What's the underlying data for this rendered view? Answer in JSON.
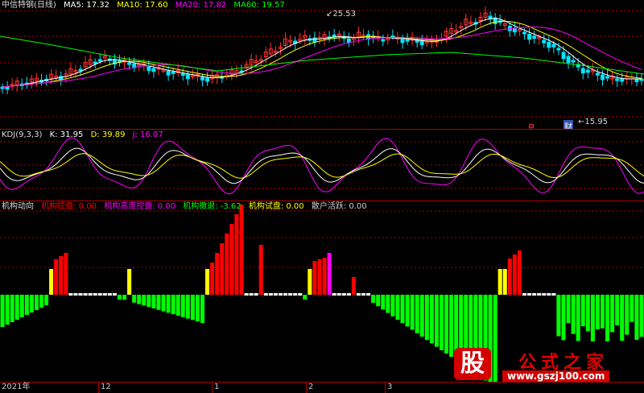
{
  "main_panel": {
    "title": "中信特钢(日线)",
    "ma": [
      {
        "label": "MA5: 17.32",
        "color": "#ffffff"
      },
      {
        "label": "MA10: 17.60",
        "color": "#ffff00"
      },
      {
        "label": "MA20: 17.82",
        "color": "#ff00ff"
      },
      {
        "label": "MA60: 19.57",
        "color": "#00ff00"
      }
    ],
    "high_label": "25.53",
    "low_label": "15.95",
    "event_mark_1": "息",
    "event_mark_2": "财"
  },
  "kdj_panel": {
    "title": "KDJ(9,3,3)",
    "k": "K: 31.95",
    "d": "D: 39.89",
    "j": "J: 16.07"
  },
  "inst_panel": {
    "title": "机构动向",
    "items": [
      {
        "label": "机构控盘: 0.00",
        "color": "#ff0000"
      },
      {
        "label": "机构高度控盘: 0.00",
        "color": "#ff00ff"
      },
      {
        "label": "机构撤退: -3.62",
        "color": "#00ff00"
      },
      {
        "label": "机构试盘: 0.00",
        "color": "#ffff00"
      },
      {
        "label": "散户活跃: 0.00",
        "color": "#cccccc"
      }
    ]
  },
  "xaxis": {
    "labels": [
      "2021年",
      "12",
      "1",
      "2",
      "3"
    ]
  },
  "watermark": {
    "glyph": "股",
    "name": "公式之家",
    "url": "www.gszj100.com"
  },
  "colors": {
    "up": "#ff3333",
    "down": "#00e5ff",
    "grid": "#b00000",
    "bar_red": "#ff0000",
    "bar_green": "#00ff00",
    "bar_yellow": "#ffff00",
    "bar_magenta": "#ff00ff"
  }
}
